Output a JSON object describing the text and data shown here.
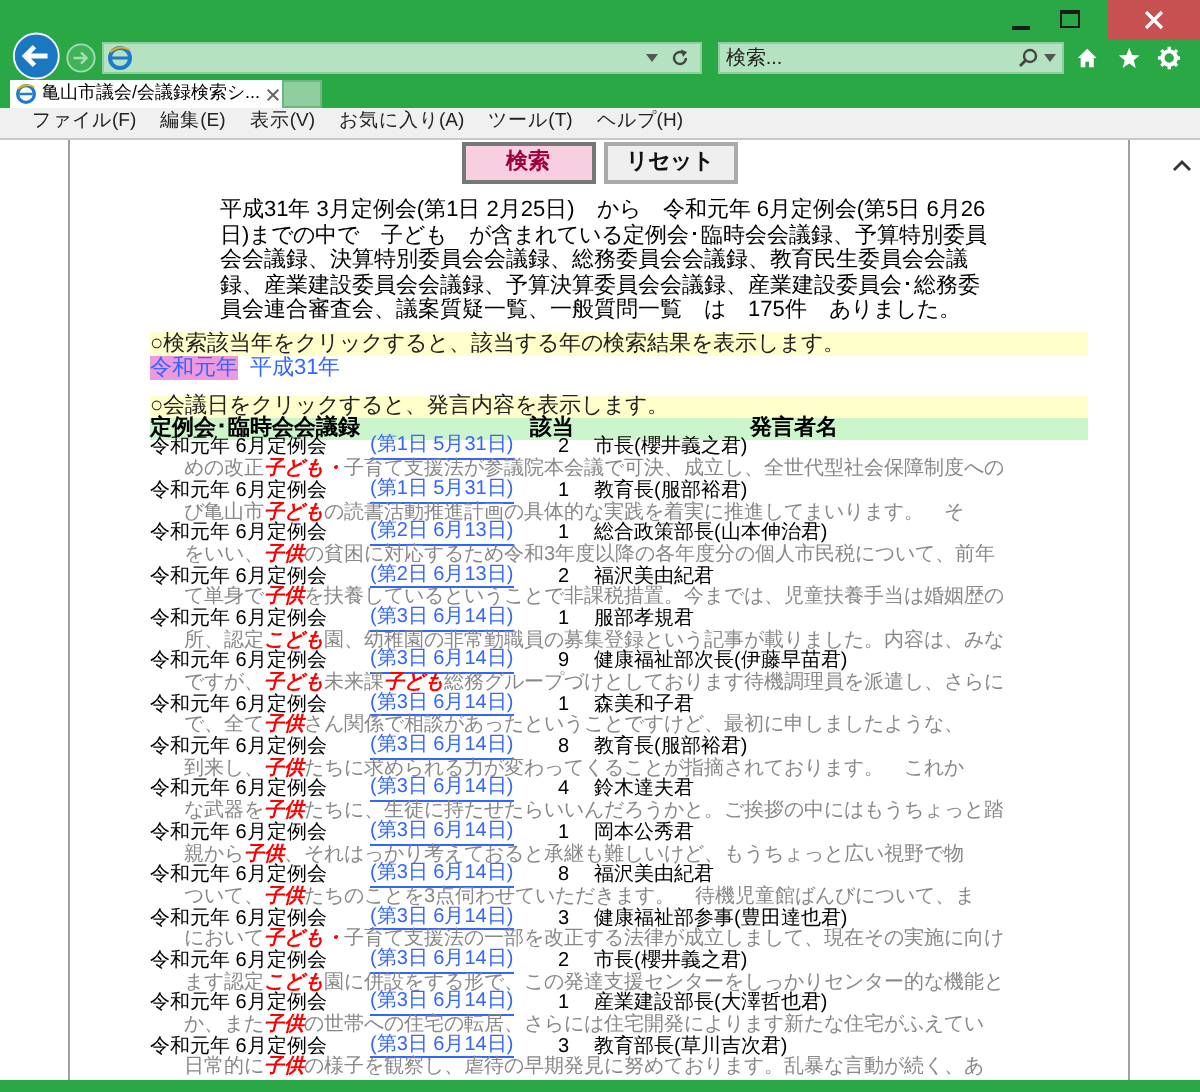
{
  "search_field": {
    "placeholder": "検索..."
  },
  "tabs": [
    {
      "label": "亀山市議会/会議録検索シ...",
      "selected": true
    }
  ],
  "menu": [
    "ファイル(F)",
    "編集(E)",
    "表示(V)",
    "お気に入り(A)",
    "ツール(T)",
    "ヘルプ(H)"
  ],
  "buttons": [
    {
      "label": "検索",
      "kind": "primary"
    },
    {
      "label": "リセット",
      "kind": "secondary"
    }
  ],
  "summary": "平成31年 3月定例会(第1日 2月25日)　から　令和元年 6月定例会(第5日 6月26日)までの中で　子ども　が含まれている定例会･臨時会会議録、予算特別委員会会議録、決算特別委員会会議録、総務委員会会議録、教育民生委員会会議録、産業建設委員会会議録、予算決算委員会会議録、産業建設委員会･総務委員会連合審査会、議案質疑一覧、一般質問一覧　は　175件　ありました。",
  "year_prompt": "○検索該当年をクリックすると、該当する年の検索結果を表示します。",
  "years": [
    {
      "label": "令和元年",
      "selected": true
    },
    {
      "label": "平成31年",
      "selected": false
    }
  ],
  "day_prompt": "○会議日をクリックすると、発言内容を表示します。",
  "columns": [
    "定例会･臨時会会議録",
    "該当",
    "発言者名"
  ],
  "results": [
    {
      "session": "令和元年 6月定例会",
      "day": "(第1日 5月31日)",
      "count": "2",
      "speaker": "市長(櫻井義之君)",
      "snippet": [
        {
          "kind": "text",
          "text": "めの改正"
        },
        {
          "kind": "hit",
          "text": "子ども・"
        },
        {
          "kind": "text",
          "text": "子育て支援法が参議院本会議で可決、成立し、全世代型社会保障制度への"
        }
      ]
    },
    {
      "session": "令和元年 6月定例会",
      "day": "(第1日 5月31日)",
      "count": "1",
      "speaker": "教育長(服部裕君)",
      "snippet": [
        {
          "kind": "text",
          "text": "び亀山市"
        },
        {
          "kind": "hit",
          "text": "子ども"
        },
        {
          "kind": "text",
          "text": "の読書活動推進計画の具体的な実践を着実に推進してまいります。　そ"
        }
      ]
    },
    {
      "session": "令和元年 6月定例会",
      "day": "(第2日 6月13日)",
      "count": "1",
      "speaker": "総合政策部長(山本伸治君)",
      "snippet": [
        {
          "kind": "text",
          "text": "をいい、"
        },
        {
          "kind": "hit",
          "text": "子供"
        },
        {
          "kind": "text",
          "text": "の貧困に対応するため令和3年度以降の各年度分の個人市民税について、前年"
        }
      ]
    },
    {
      "session": "令和元年 6月定例会",
      "day": "(第2日 6月13日)",
      "count": "2",
      "speaker": "福沢美由紀君",
      "snippet": [
        {
          "kind": "text",
          "text": "て単身で"
        },
        {
          "kind": "hit",
          "text": "子供"
        },
        {
          "kind": "text",
          "text": "を扶養しているということで非課税措置。今までは、児童扶養手当は婚姻歴の"
        }
      ]
    },
    {
      "session": "令和元年 6月定例会",
      "day": "(第3日 6月14日)",
      "count": "1",
      "speaker": "服部孝規君",
      "snippet": [
        {
          "kind": "text",
          "text": "所、認定"
        },
        {
          "kind": "hit",
          "text": "こども"
        },
        {
          "kind": "text",
          "text": "園、幼稚園の非常勤職員の募集登録という記事が載りました。内容は、みな"
        }
      ]
    },
    {
      "session": "令和元年 6月定例会",
      "day": "(第3日 6月14日)",
      "count": "9",
      "speaker": "健康福祉部次長(伊藤早苗君)",
      "snippet": [
        {
          "kind": "text",
          "text": "ですが、"
        },
        {
          "kind": "hit",
          "text": "子ども"
        },
        {
          "kind": "text",
          "text": "未来課"
        },
        {
          "kind": "hit",
          "text": "子ども"
        },
        {
          "kind": "text",
          "text": "総務グループづけとしております待機調理員を派遣し、さらに"
        }
      ]
    },
    {
      "session": "令和元年 6月定例会",
      "day": "(第3日 6月14日)",
      "count": "1",
      "speaker": "森美和子君",
      "snippet": [
        {
          "kind": "text",
          "text": "で、全て"
        },
        {
          "kind": "hit",
          "text": "子供"
        },
        {
          "kind": "text",
          "text": "さん関係で相談があったということですけど、最初に申しましたような、"
        }
      ]
    },
    {
      "session": "令和元年 6月定例会",
      "day": "(第3日 6月14日)",
      "count": "8",
      "speaker": "教育長(服部裕君)",
      "snippet": [
        {
          "kind": "text",
          "text": "到来し、"
        },
        {
          "kind": "hit",
          "text": "子供"
        },
        {
          "kind": "text",
          "text": "たちに求められる力が変わってくることが指摘されております。　これか"
        }
      ]
    },
    {
      "session": "令和元年 6月定例会",
      "day": "(第3日 6月14日)",
      "count": "4",
      "speaker": "鈴木達夫君",
      "snippet": [
        {
          "kind": "text",
          "text": "な武器を"
        },
        {
          "kind": "hit",
          "text": "子供"
        },
        {
          "kind": "text",
          "text": "たちに、生徒に持たせたらいいんだろうかと。ご挨拶の中にはもうちょっと踏"
        }
      ]
    },
    {
      "session": "令和元年 6月定例会",
      "day": "(第3日 6月14日)",
      "count": "1",
      "speaker": "岡本公秀君",
      "snippet": [
        {
          "kind": "text",
          "text": "親から"
        },
        {
          "kind": "hit",
          "text": "子供"
        },
        {
          "kind": "text",
          "text": "、それはっかり考えておると承継も難しいけど、もうちょっと広い視野で物"
        }
      ]
    },
    {
      "session": "令和元年 6月定例会",
      "day": "(第3日 6月14日)",
      "count": "8",
      "speaker": "福沢美由紀君",
      "snippet": [
        {
          "kind": "text",
          "text": "ついて、"
        },
        {
          "kind": "hit",
          "text": "子供"
        },
        {
          "kind": "text",
          "text": "たちのことを3点伺わせていただきます。　待機児童館ばんびについて、ま"
        }
      ]
    },
    {
      "session": "令和元年 6月定例会",
      "day": "(第3日 6月14日)",
      "count": "3",
      "speaker": "健康福祉部参事(豊田達也君)",
      "snippet": [
        {
          "kind": "text",
          "text": "において"
        },
        {
          "kind": "hit",
          "text": "子ども・"
        },
        {
          "kind": "text",
          "text": "子育て支援法の一部を改正する法律が成立しまして、現在その実施に向け"
        }
      ]
    },
    {
      "session": "令和元年 6月定例会",
      "day": "(第3日 6月14日)",
      "count": "2",
      "speaker": "市長(櫻井義之君)",
      "snippet": [
        {
          "kind": "text",
          "text": "ます認定"
        },
        {
          "kind": "hit",
          "text": "こども"
        },
        {
          "kind": "text",
          "text": "園に併設をする形で、この発達支援センターをしっかりセンター的な機能と"
        }
      ]
    },
    {
      "session": "令和元年 6月定例会",
      "day": "(第3日 6月14日)",
      "count": "1",
      "speaker": "産業建設部長(大澤哲也君)",
      "snippet": [
        {
          "kind": "text",
          "text": "か、また"
        },
        {
          "kind": "hit",
          "text": "子供"
        },
        {
          "kind": "text",
          "text": "の世帯への住宅の転居、さらには住宅開発によります新たな住宅がふえてい"
        }
      ]
    },
    {
      "session": "令和元年 6月定例会",
      "day": "(第3日 6月14日)",
      "count": "3",
      "speaker": "教育部長(草川吉次君)",
      "snippet": [
        {
          "kind": "text",
          "text": "日常的に"
        },
        {
          "kind": "hit",
          "text": "子供"
        },
        {
          "kind": "text",
          "text": "の様子を観察し、虐待の早期発見に努めております。乱暴な言動が続く、あ"
        }
      ]
    }
  ]
}
